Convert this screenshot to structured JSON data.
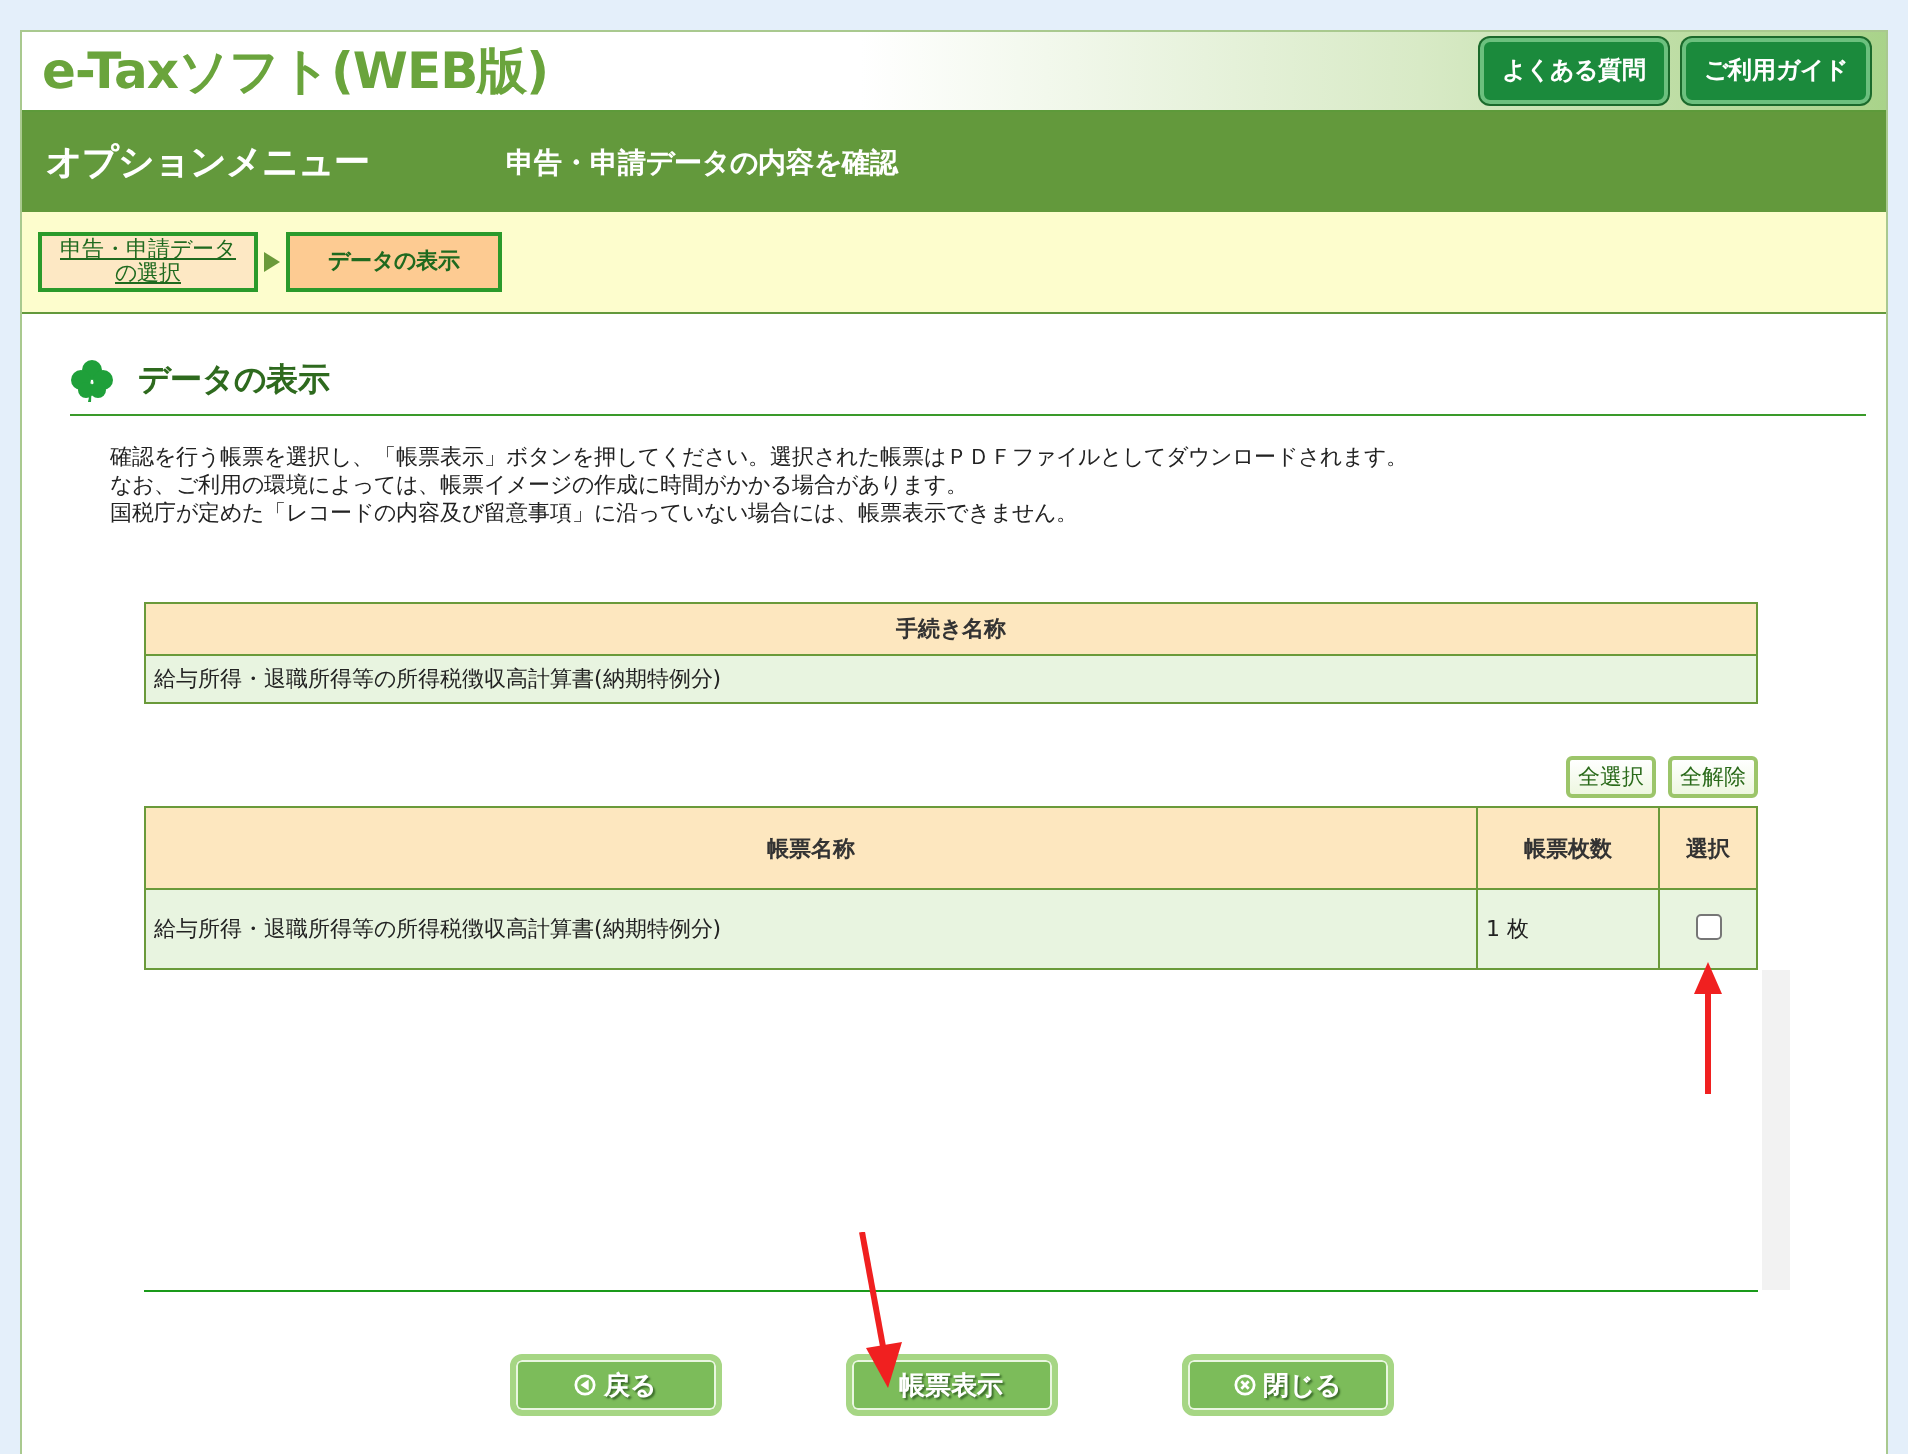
{
  "header": {
    "logo": "e-Taxソフト(WEB版)",
    "links": [
      "よくある質問",
      "ご利用ガイド"
    ]
  },
  "title_bar": {
    "title": "オプションメニュー",
    "subtitle": "申告・申請データの内容を確認"
  },
  "breadcrumb": [
    {
      "label": "申告・申請データの選択",
      "selected": false
    },
    {
      "label": "データの表示",
      "selected": true
    }
  ],
  "section": {
    "heading": "データの表示",
    "instructions": [
      "確認を行う帳票を選択し、「帳票表示」ボタンを押してください。選択された帳票はＰＤＦファイルとしてダウンロードされます。",
      "なお、ご利用の環境によっては、帳票イメージの作成に時間がかかる場合があります。",
      "国税庁が定めた「レコードの内容及び留意事項」に沿っていない場合には、帳票表示できません。"
    ]
  },
  "procedure_table": {
    "column": "手続き名称",
    "cell": "給与所得・退職所得等の所得税徴収高計算書(納期特例分)"
  },
  "select_buttons": [
    "全選択",
    "全解除"
  ],
  "forms_table": {
    "columns": [
      "帳票名称",
      "帳票枚数",
      "選択"
    ],
    "rows": [
      {
        "name": "給与所得・退職所得等の所得税徴収高計算書(納期特例分)",
        "count": "1 枚",
        "checked": false
      }
    ]
  },
  "footer_buttons": [
    {
      "label": "戻る",
      "kind": "back"
    },
    {
      "label": "帳票表示",
      "kind": "primary"
    },
    {
      "label": "閉じる",
      "kind": "close"
    }
  ]
}
